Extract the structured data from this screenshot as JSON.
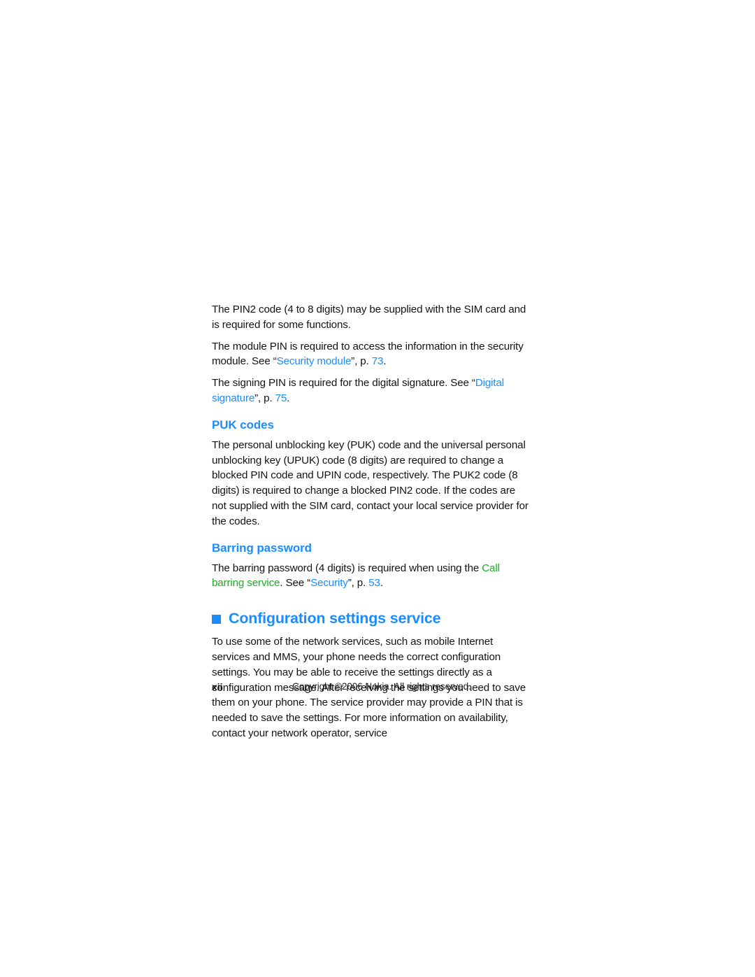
{
  "colors": {
    "link_blue": "#1a8cff",
    "menu_green": "#1faa22",
    "body_text": "#131313",
    "page_background": "#ffffff"
  },
  "content": {
    "paragraph_pin2": "The PIN2 code (4 to 8 digits) may be supplied with the SIM card and is required for some functions.",
    "paragraph_module_pin": {
      "before": "The module PIN is required to access the information in the security module. See “",
      "link": "Security module",
      "middle": "”, p. ",
      "page": "73",
      "after": "."
    },
    "paragraph_signing_pin": {
      "before": "The signing PIN is required for the digital signature. See “",
      "link": "Digital signature",
      "middle": "”, p. ",
      "page": "75",
      "after": "."
    },
    "heading_puk_codes": "PUK codes",
    "paragraph_puk": "The personal unblocking key (PUK) code and the universal personal unblocking key (UPUK) code (8 digits) are required to change a blocked PIN code and UPIN code, respectively. The PUK2 code (8 digits) is required to change a blocked PIN2 code. If the codes are not supplied with the SIM card, contact your local service provider for the codes.",
    "heading_barring_password": "Barring password",
    "paragraph_barring": {
      "before": "The barring password (4 digits) is required when using the ",
      "menu_path": "Call barring service",
      "middle": ". See “",
      "link": "Security",
      "middle2": "”, p. ",
      "page": "53",
      "after": "."
    },
    "heading_configuration": "Configuration settings service",
    "paragraph_configuration": "To use some of the network services, such as mobile Internet services and MMS, your phone needs the correct configuration settings. You may be able to receive the settings directly as a configuration message. After receiving the settings you need to save them on your phone. The service provider may provide a PIN that is needed to save the settings. For more information on availability, contact your network operator, service"
  },
  "footer": {
    "page_number": "xii",
    "copyright": "Copyright ©2006 Nokia. All rights reserved."
  }
}
